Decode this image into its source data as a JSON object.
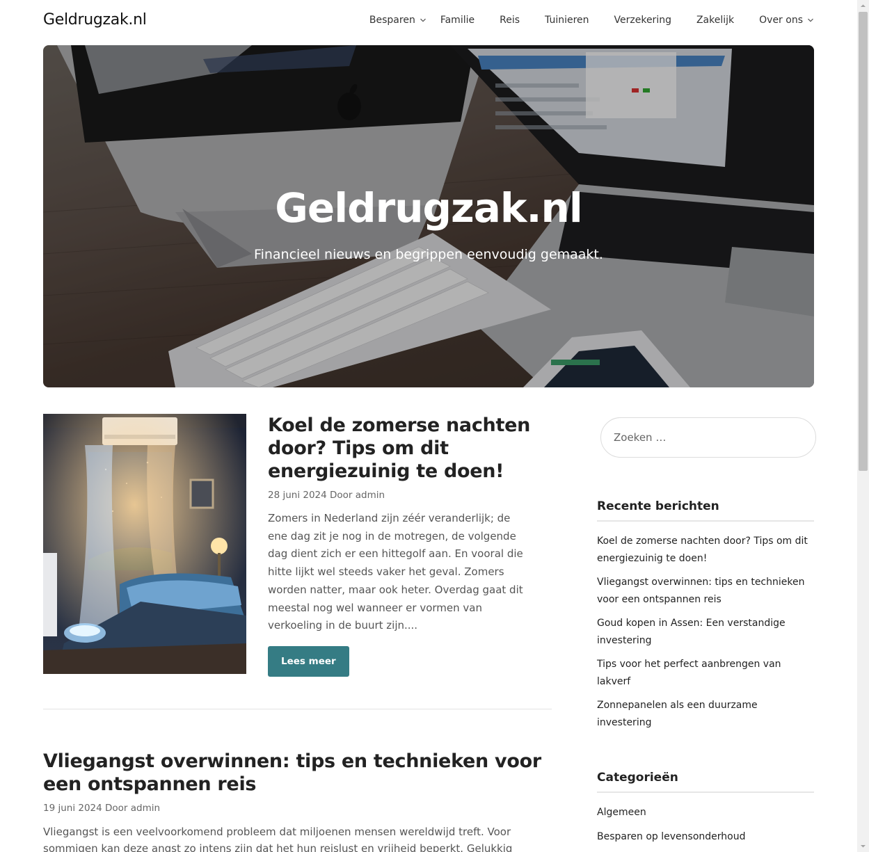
{
  "header": {
    "brand": "Geldrugzak.nl",
    "nav": [
      {
        "label": "Besparen",
        "dropdown": true
      },
      {
        "label": "Familie",
        "dropdown": false
      },
      {
        "label": "Reis",
        "dropdown": false
      },
      {
        "label": "Tuinieren",
        "dropdown": false
      },
      {
        "label": "Verzekering",
        "dropdown": false
      },
      {
        "label": "Zakelijk",
        "dropdown": false
      },
      {
        "label": "Over ons",
        "dropdown": true
      }
    ]
  },
  "hero": {
    "title": "Geldrugzak.nl",
    "subtitle": "Financieel nieuws en begrippen eenvoudig gemaakt."
  },
  "posts": [
    {
      "title": "Koel de zomerse nachten door? Tips om dit energiezuinig te doen!",
      "meta": "28 juni 2024 Door admin",
      "excerpt": "Zomers in Nederland zijn zéér veranderlijk; de ene dag zit je nog in de motregen, de volgende dag dient zich er een hittegolf aan. En vooral die hitte lijkt wel steeds vaker het geval. Zomers worden natter, maar ook heter. Overdag gaat dit meestal nog wel wanneer er vormen van verkoeling in de buurt zijn....",
      "button": "Lees meer"
    },
    {
      "title": "Vliegangst overwinnen: tips en technieken voor een ontspannen reis",
      "meta": "19 juni 2024 Door admin",
      "excerpt": "Vliegangst is een veelvoorkomend probleem dat miljoenen mensen wereldwijd treft. Voor sommigen kan deze angst zo intens zijn dat het hun reislust en vrijheid beperkt. Gelukkig"
    }
  ],
  "sidebar": {
    "search_placeholder": "Zoeken …",
    "recent_title": "Recente berichten",
    "recent": [
      "Koel de zomerse nachten door? Tips om dit energiezuinig te doen!",
      "Vliegangst overwinnen: tips en technieken voor een ontspannen reis",
      "Goud kopen in Assen: Een verstandige investering",
      "Tips voor het perfect aanbrengen van lakverf",
      "Zonnepanelen als een duurzame investering"
    ],
    "categories_title": "Categorieën",
    "categories": [
      "Algemeen",
      "Besparen op levensonderhoud"
    ]
  },
  "colors": {
    "button": "#357c84",
    "text": "#1f1f1f",
    "muted": "#555555"
  }
}
